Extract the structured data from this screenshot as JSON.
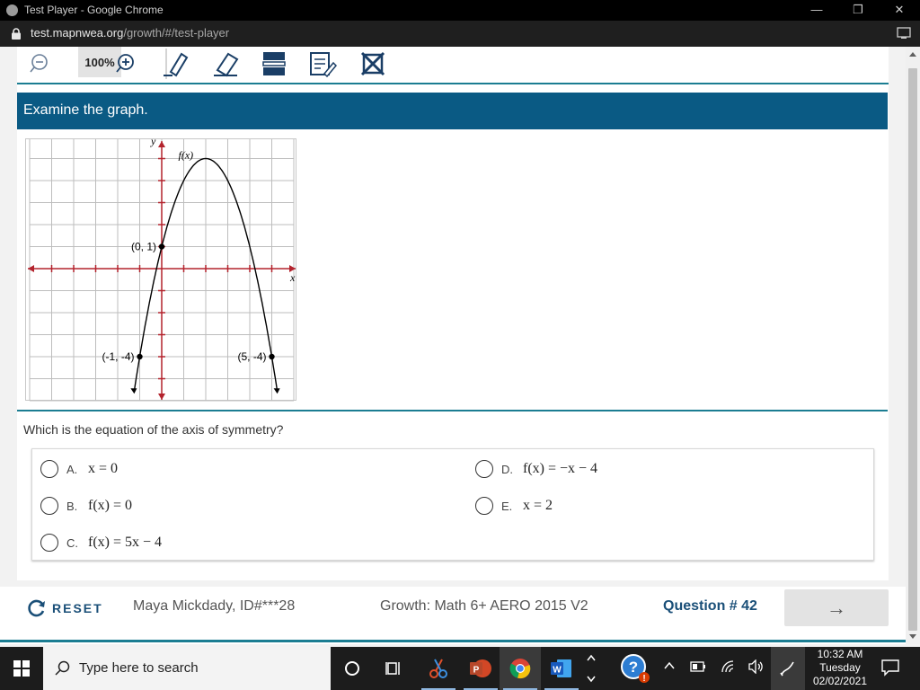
{
  "window": {
    "title": "Test Player - Google Chrome",
    "url_host": "test.mapnwea.org",
    "url_path": "/growth/#/test-player"
  },
  "toolbar": {
    "zoom_level": "100%",
    "tools": [
      "zoom-out-icon",
      "zoom-in-icon",
      "highlighter-icon",
      "eraser-icon",
      "line-reader-icon",
      "notepad-icon",
      "answer-eliminator-icon"
    ]
  },
  "item": {
    "prompt": "Examine the graph.",
    "question": "Which is the equation of the axis of symmetry?",
    "graph": {
      "y_axis_label": "y",
      "x_axis_label": "x",
      "curve_label": "f(x)",
      "points": [
        {
          "label": "(0, 1)",
          "x": 0,
          "y": 1
        },
        {
          "label": "(-1, -4)",
          "x": -1,
          "y": -4
        },
        {
          "label": "(5, -4)",
          "x": 5,
          "y": -4
        }
      ],
      "vertex": {
        "x": 2,
        "y": 5
      },
      "x_range": [
        -6,
        6
      ],
      "y_range": [
        -6,
        6
      ]
    },
    "options": [
      {
        "letter": "A.",
        "equation": "x = 0"
      },
      {
        "letter": "B.",
        "equation": "f(x) = 0"
      },
      {
        "letter": "C.",
        "equation": "f(x) = 5x − 4"
      },
      {
        "letter": "D.",
        "equation": "f(x) = −x − 4"
      },
      {
        "letter": "E.",
        "equation": "x = 2"
      }
    ]
  },
  "footer": {
    "reset_label": "RESET",
    "student": "Maya Mickdady, ID#***28",
    "test_name": "Growth: Math 6+ AERO 2015 V2",
    "question_number": "Question # 42",
    "next_arrow": "→"
  },
  "taskbar": {
    "search_placeholder": "Type here to search",
    "apps": [
      "cortana-icon",
      "task-view-icon",
      "snip-icon",
      "powerpoint-icon",
      "chrome-icon",
      "word-icon",
      "help-icon"
    ],
    "time": "10:32 AM",
    "day": "Tuesday",
    "date": "02/02/2021"
  },
  "colors": {
    "prompt_band": "#0a5a84",
    "accent_teal": "#1b7d92",
    "axis_red": "#b3232d",
    "footer_blue": "#1a4f78"
  }
}
